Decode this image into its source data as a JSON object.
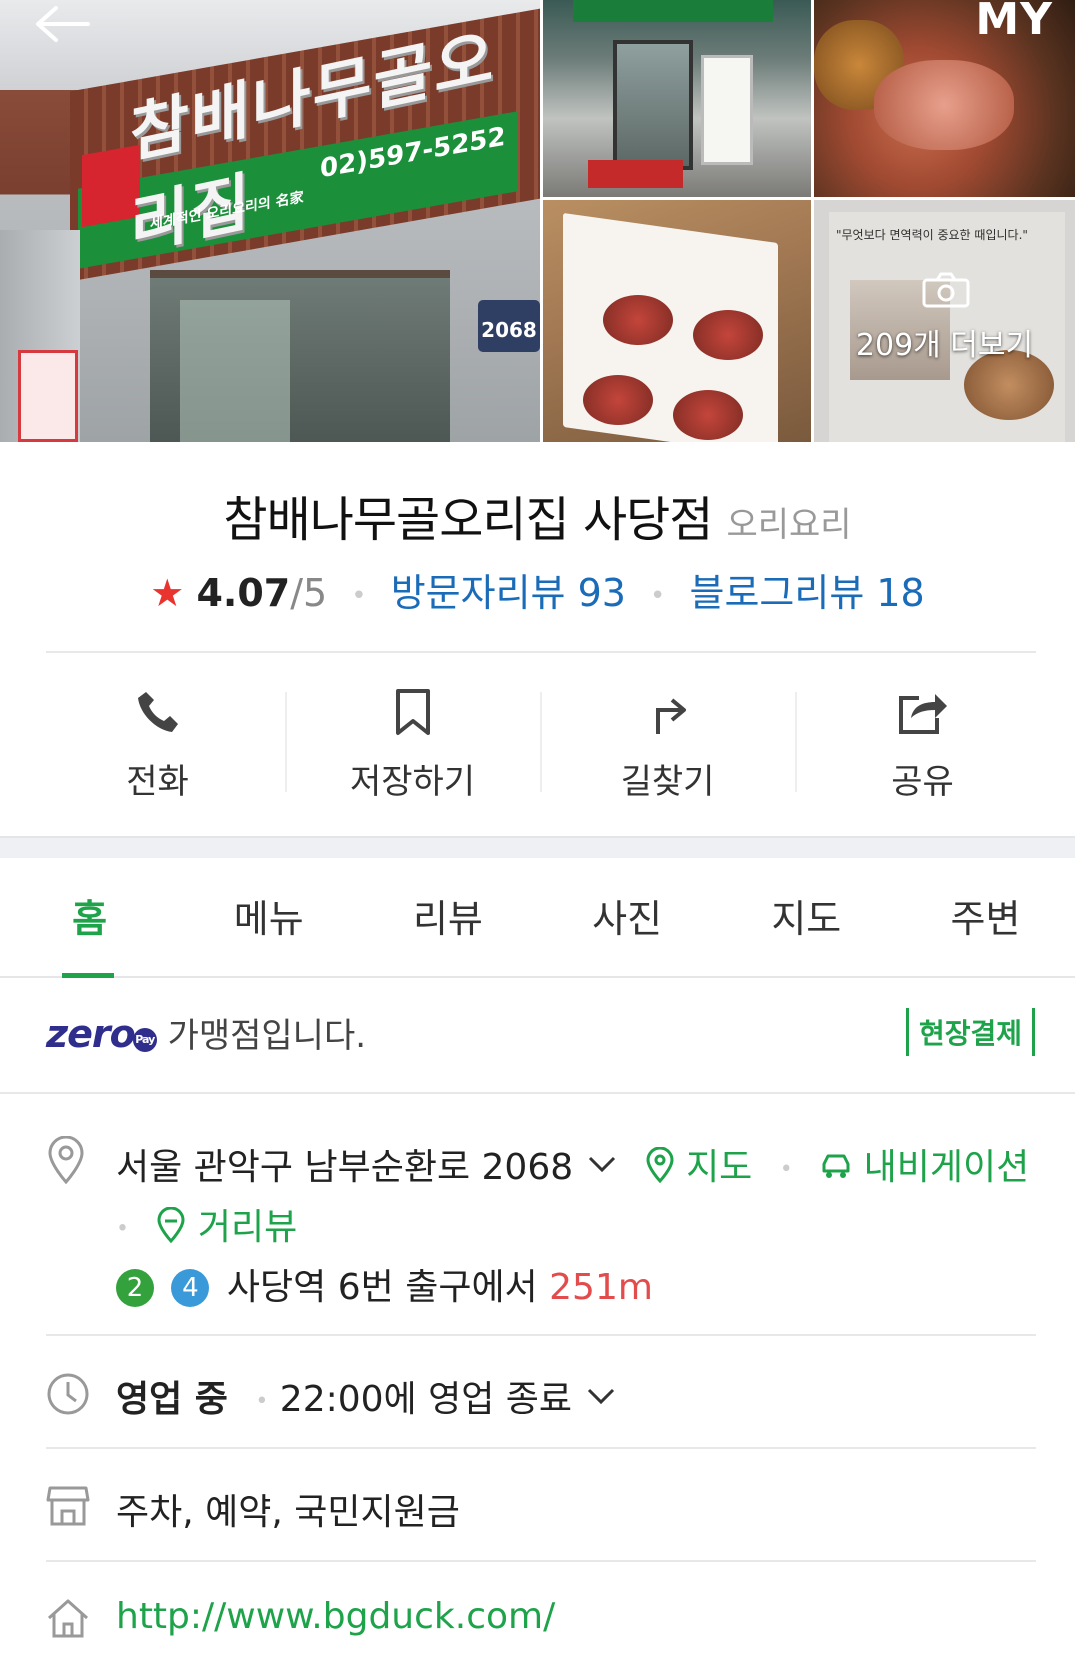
{
  "gallery": {
    "main_sign_text": "참배나무골오리집",
    "main_sign_phone": "02)597-5252",
    "main_sign_sub": "세계적인 오리요리의 名家",
    "building_number": "2068",
    "corner_text": "MY",
    "more_label": "209개 더보기",
    "paper_title": "\"무엇보다 면역력이 중요한 때입니다.\""
  },
  "place": {
    "name": "참배나무골오리집 사당점",
    "category": "오리요리",
    "rating": "4.07",
    "rating_max": "/5",
    "visitor_reviews": "방문자리뷰 93",
    "blog_reviews": "블로그리뷰 18"
  },
  "actions": [
    {
      "label": "전화",
      "icon": "phone-icon"
    },
    {
      "label": "저장하기",
      "icon": "bookmark-icon"
    },
    {
      "label": "길찾기",
      "icon": "directions-icon"
    },
    {
      "label": "공유",
      "icon": "share-icon"
    }
  ],
  "tabs": [
    "홈",
    "메뉴",
    "리뷰",
    "사진",
    "지도",
    "주변"
  ],
  "zeropay": {
    "logo": "zero",
    "logo_pay": "Pay",
    "text": "가맹점입니다.",
    "badge": "현장결제"
  },
  "address": {
    "text": "서울 관악구 남부순환로 2068",
    "map_link": "지도",
    "navigation_link": "내비게이션",
    "streetview_link": "거리뷰"
  },
  "subway": {
    "lines": [
      {
        "number": "2",
        "color": "#33a23d"
      },
      {
        "number": "4",
        "color": "#3a9ad9"
      }
    ],
    "station": "사당역",
    "exit_text": "6번 출구에서",
    "distance": "251m"
  },
  "hours": {
    "status": "영업 중",
    "detail": "22:00에 영업 종료"
  },
  "facilities": "주차, 예약, 국민지원금",
  "website": "http://www.bgduck.com/",
  "colors": {
    "accent_green": "#1ea34b",
    "link_blue": "#1a6bb8",
    "star_red": "#e8332e",
    "distance_red": "#e34c4c"
  }
}
